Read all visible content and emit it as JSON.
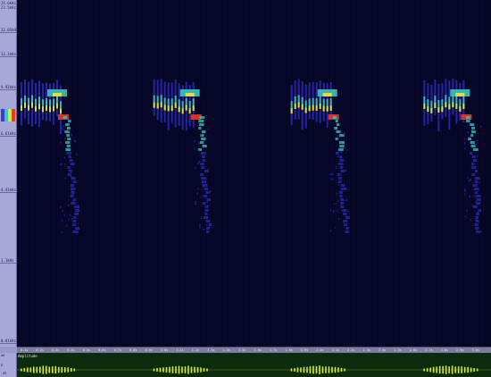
{
  "frequency_axis": {
    "top_labels": [
      "24.0kHz",
      "23.5kHz"
    ],
    "ticks": [
      {
        "label": "22.05kHz",
        "frac": 0.095
      },
      {
        "label": "13.1kHz",
        "frac": 0.165
      },
      {
        "label": "9.92kHz",
        "frac": 0.26
      },
      {
        "label": "6.61kHz",
        "frac": 0.395
      },
      {
        "label": "4.41kHz",
        "frac": 0.56
      },
      {
        "label": "1.1kHz",
        "frac": 0.765
      },
      {
        "label": "0.01kHz",
        "frac": 1.0
      }
    ]
  },
  "time_axis": {
    "labels": [
      "0.1s",
      "0.2s",
      "0.3s",
      "0.4s",
      "0.5s",
      "0.6s",
      "0.7s",
      "0.8s",
      "0.9s",
      "1.0s",
      "1.1s",
      "1.2s",
      "1.3s",
      "1.4s",
      "1.5s",
      "1.6s",
      "1.7s",
      "1.8s",
      "1.9s",
      "2.0s",
      "2.1s",
      "2.2s",
      "2.3s",
      "2.4s",
      "2.5s",
      "2.6s",
      "2.7s",
      "2.8s",
      "2.9s",
      "3.0s"
    ]
  },
  "amplitude": {
    "title": "Amplitude",
    "labels": [
      "dB",
      "0",
      "-99"
    ]
  },
  "colors": {
    "background": "#050524",
    "ruler": "#a8a8d8",
    "waveform": "#d4e83a",
    "amp_bg": "#0c2a0c"
  },
  "calls": [
    {
      "start": 0.0
    },
    {
      "start": 0.28
    },
    {
      "start": 0.57
    },
    {
      "start": 0.85
    }
  ]
}
